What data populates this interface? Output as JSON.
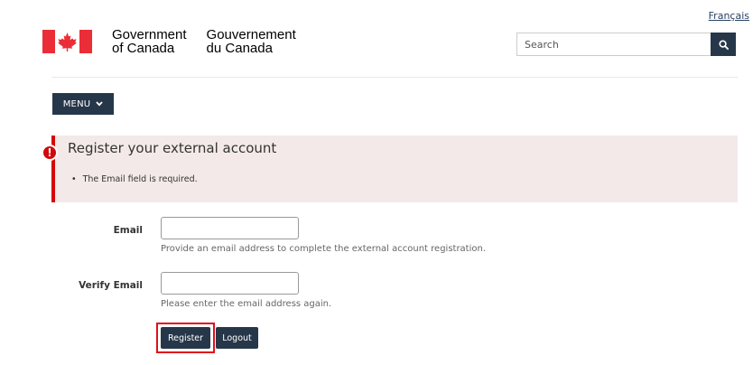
{
  "header": {
    "language_link": "Français",
    "brand": {
      "en_line1": "Government",
      "en_line2": "of Canada",
      "fr_line1": "Gouvernement",
      "fr_line2": "du Canada"
    },
    "search": {
      "placeholder": "Search",
      "button_icon": "search-icon"
    }
  },
  "nav": {
    "menu_label": "MENU"
  },
  "alert": {
    "title": "Register your external account",
    "errors": [
      "The Email field is required."
    ],
    "icon": "exclamation-icon"
  },
  "form": {
    "email": {
      "label": "Email",
      "value": "",
      "help": "Provide an email address to complete the external account registration."
    },
    "verify_email": {
      "label": "Verify Email",
      "value": "",
      "help": "Please enter the email address again."
    },
    "buttons": {
      "register": "Register",
      "logout": "Logout"
    }
  },
  "colors": {
    "primary": "#26374a",
    "error": "#d3080c",
    "alert_bg": "#f3e9e8",
    "flag_red": "#eb2d37",
    "highlight": "#e0101b"
  }
}
